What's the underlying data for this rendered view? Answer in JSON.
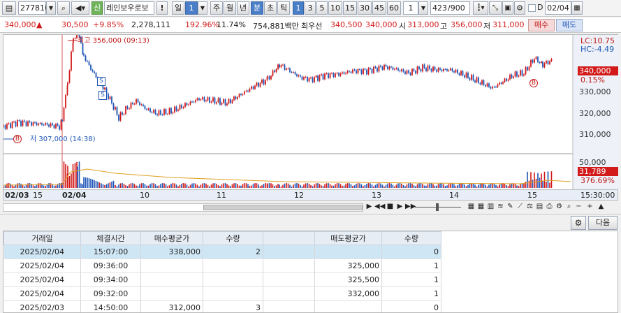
{
  "toolbar": {
    "code": "277810",
    "credit_badge": "신",
    "stock_name": "레인보우로보",
    "alert": "!",
    "period_day": "일",
    "period_num": "1",
    "week": "주",
    "month": "월",
    "year": "년",
    "minute": "분",
    "second": "초",
    "tick": "틱",
    "intervals": [
      "1",
      "3",
      "5",
      "10",
      "15",
      "30",
      "45",
      "60"
    ],
    "interval_value": "1",
    "count_current": "423",
    "count_total": "/900",
    "date_check": "D",
    "date": "02/04"
  },
  "quote": {
    "price": "340,000",
    "change_arrow": "▲",
    "change": "30,500",
    "change_pct": "+9.85%",
    "volume": "2,278,111",
    "vol_ratio": "192.96%",
    "turnover": "11.74%",
    "amount": "754,881백만",
    "best_label": "최우선",
    "ask": "340,500",
    "bid": "340,000",
    "open_label": "시",
    "open": "313,000",
    "high_label": "고",
    "high": "356,000",
    "low_label": "저",
    "low": "311,000",
    "buy": "매수",
    "sell": "매도"
  },
  "chart": {
    "lc": "LC:10.75",
    "hc": "HC:-4.49",
    "price_tag": "340,000",
    "pct_tag": "0.15%",
    "y_ticks": [
      "330,000",
      "320,000",
      "310,000"
    ],
    "vol_tick": "50,000",
    "vol_tag": "31,789",
    "vol_pct": "376.69%",
    "high_annot": "최고 356,000 (09:13)",
    "low_annot": "저 307,000 (14:38)",
    "marker_b": "B",
    "marker_s": "S",
    "x_labels": [
      "02/03",
      "15",
      "02/04",
      "10",
      "11",
      "12",
      "13",
      "14",
      "15"
    ],
    "time": "15:30:00"
  },
  "panel": {
    "next": "다음",
    "settings_icon": "gear-icon"
  },
  "table": {
    "headers": [
      "거래일",
      "체결시간",
      "매수평균가",
      "수량",
      "",
      "매도평균가",
      "수량"
    ],
    "rows": [
      {
        "date": "2025/02/04",
        "time": "15:07:00",
        "buy_avg": "338,000",
        "buy_qty": "2",
        "sell_avg": "",
        "sell_qty": "0"
      },
      {
        "date": "2025/02/04",
        "time": "09:36:00",
        "buy_avg": "",
        "buy_qty": "",
        "sell_avg": "325,000",
        "sell_qty": "1"
      },
      {
        "date": "2025/02/04",
        "time": "09:34:00",
        "buy_avg": "",
        "buy_qty": "",
        "sell_avg": "325,500",
        "sell_qty": "1"
      },
      {
        "date": "2025/02/04",
        "time": "09:32:00",
        "buy_avg": "",
        "buy_qty": "",
        "sell_avg": "332,000",
        "sell_qty": "1"
      },
      {
        "date": "2025/02/03",
        "time": "14:50:00",
        "buy_avg": "312,000",
        "buy_qty": "3",
        "sell_avg": "",
        "sell_qty": "0"
      }
    ]
  },
  "colors": {
    "up": "#d21a1a",
    "down": "#1d55b7",
    "accent": "#4a7fc8",
    "highlight_row": "#cfe6f5"
  }
}
